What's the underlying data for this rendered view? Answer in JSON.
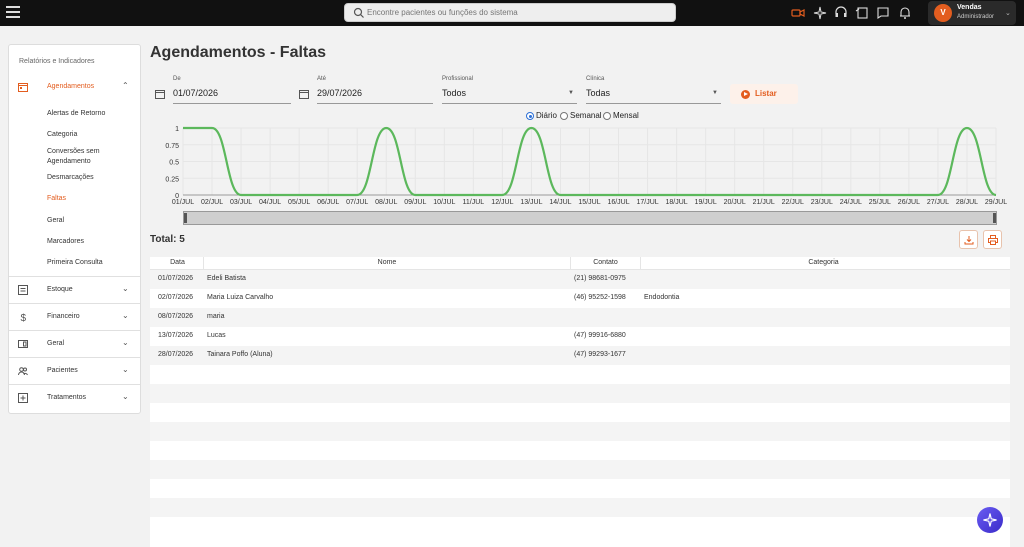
{
  "topbar": {
    "search_placeholder": "Encontre pacientes ou funções do sistema",
    "user": {
      "initial": "V",
      "name": "Vendas",
      "role": "Administrador"
    }
  },
  "sidebar": {
    "title": "Relatórios e Indicadores",
    "sections": [
      {
        "label": "Agendamentos",
        "icon": "calendar-icon",
        "expanded": true
      },
      {
        "label": "Estoque",
        "icon": "box-icon"
      },
      {
        "label": "Financeiro",
        "icon": "dollar-icon"
      },
      {
        "label": "Geral",
        "icon": "card-icon"
      },
      {
        "label": "Pacientes",
        "icon": "people-icon"
      },
      {
        "label": "Tratamentos",
        "icon": "plus-square-icon"
      }
    ],
    "subitems": [
      "Alertas de Retorno",
      "Categoria",
      "Conversões sem Agendamento",
      "Desmarcações",
      "Faltas",
      "Geral",
      "Marcadores",
      "Primeira Consulta"
    ],
    "active_subitem": "Faltas"
  },
  "page": {
    "title": "Agendamentos - Faltas"
  },
  "filters": {
    "de": {
      "label": "De",
      "value": "01/07/2026"
    },
    "ate": {
      "label": "Até",
      "value": "29/07/2026"
    },
    "profissional": {
      "label": "Profissional",
      "value": "Todos"
    },
    "clinica": {
      "label": "Clínica",
      "value": "Todas"
    },
    "listar_label": "Listar"
  },
  "period": {
    "options": [
      "Diário",
      "Semanal",
      "Mensal"
    ],
    "selected": "Diário"
  },
  "chart_data": {
    "type": "line",
    "x": [
      "01/JUL",
      "02/JUL",
      "03/JUL",
      "04/JUL",
      "05/JUL",
      "06/JUL",
      "07/JUL",
      "08/JUL",
      "09/JUL",
      "10/JUL",
      "11/JUL",
      "12/JUL",
      "13/JUL",
      "14/JUL",
      "15/JUL",
      "16/JUL",
      "17/JUL",
      "18/JUL",
      "19/JUL",
      "20/JUL",
      "21/JUL",
      "22/JUL",
      "23/JUL",
      "24/JUL",
      "25/JUL",
      "26/JUL",
      "27/JUL",
      "28/JUL",
      "29/JUL"
    ],
    "series": [
      {
        "values": [
          1,
          1,
          0,
          0,
          0,
          0,
          0,
          1,
          0,
          0,
          0,
          0,
          1,
          0,
          0,
          0,
          0,
          0,
          0,
          0,
          0,
          0,
          0,
          0,
          0,
          0,
          0,
          1,
          0
        ],
        "color": "#5cb85c"
      }
    ],
    "yticks": [
      "0",
      "0.25",
      "0.5",
      "0.75",
      "1"
    ],
    "ylim": [
      0,
      1
    ],
    "grid": true
  },
  "summary": {
    "total_label": "Total: 5"
  },
  "table": {
    "columns": [
      "Data",
      "Nome",
      "Contato",
      "Categoria"
    ],
    "rows": [
      {
        "data": "01/07/2026",
        "nome": "Edeli Batista",
        "contato": "(21) 98681-0975",
        "categoria": ""
      },
      {
        "data": "02/07/2026",
        "nome": "Maria Luiza Carvalho",
        "contato": "(46) 95252-1598",
        "categoria": "Endodontia"
      },
      {
        "data": "08/07/2026",
        "nome": "maria",
        "contato": "",
        "categoria": ""
      },
      {
        "data": "13/07/2026",
        "nome": "Lucas",
        "contato": "(47) 99916-6880",
        "categoria": ""
      },
      {
        "data": "28/07/2026",
        "nome": "Tainara Poffo (Aluna)",
        "contato": "(47) 99293-1677",
        "categoria": ""
      }
    ]
  },
  "colors": {
    "accent": "#e35d1f",
    "line": "#5cb85c",
    "topbar": "#111111"
  }
}
